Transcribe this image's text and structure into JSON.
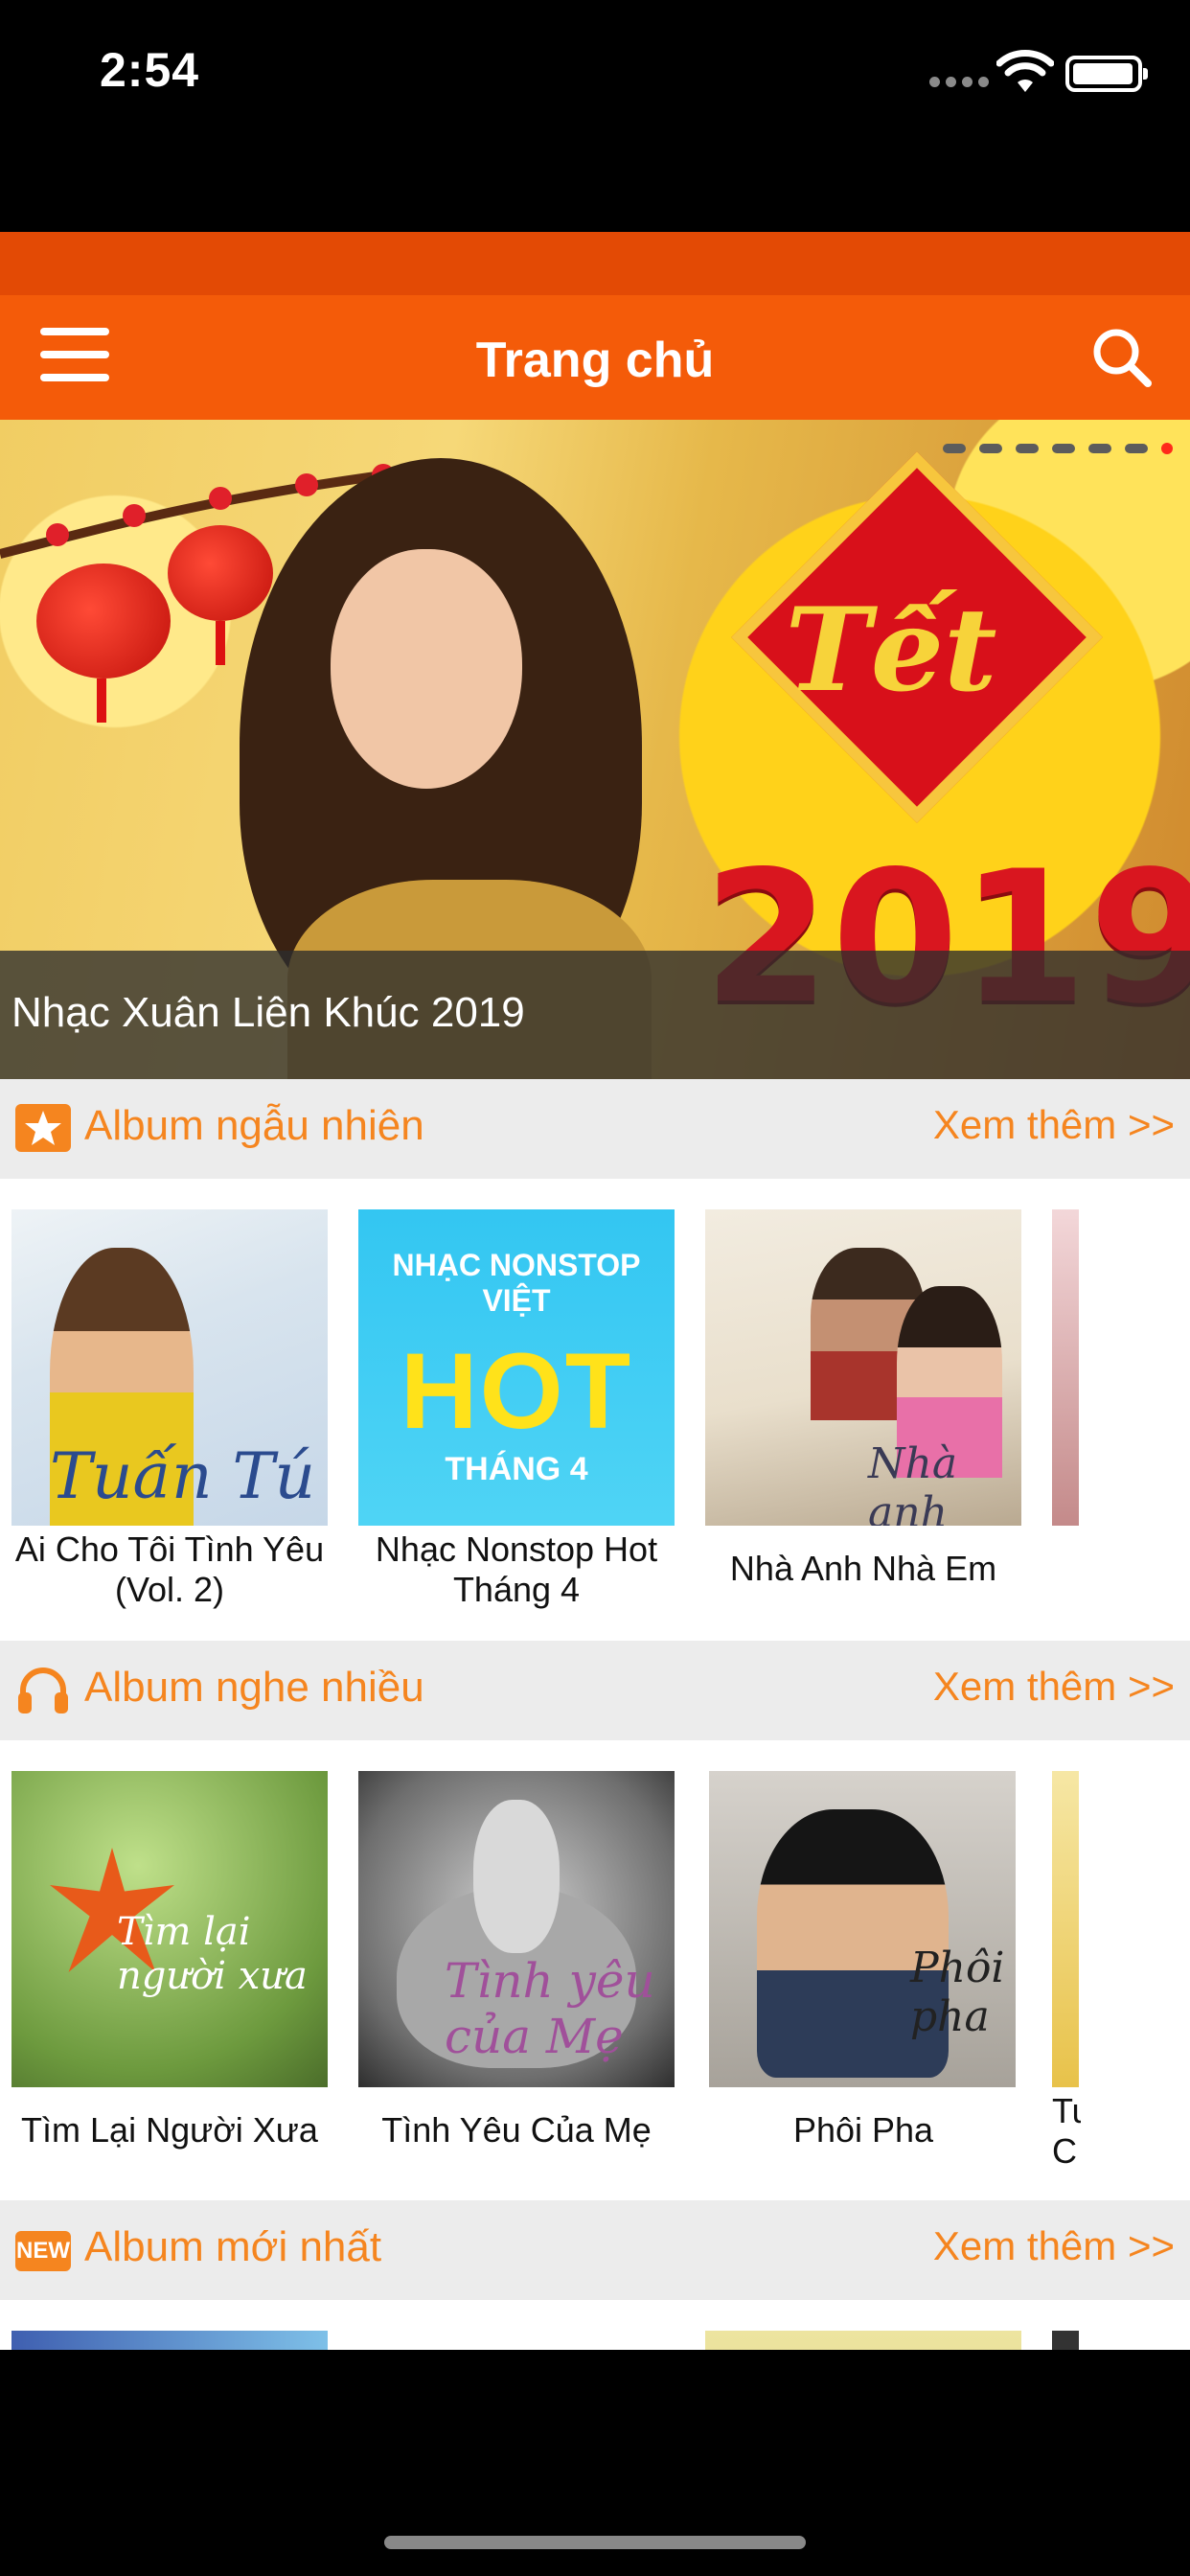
{
  "status_bar": {
    "time": "2:54"
  },
  "nav": {
    "title": "Trang chủ",
    "menu_icon": "hamburger-menu-icon",
    "search_icon": "search-icon"
  },
  "banner": {
    "caption": "Nhạc Xuân Liên Khúc 2019",
    "art_text": "Tết",
    "art_year": "2019",
    "page_count": 7,
    "active_page": 7
  },
  "sections": [
    {
      "title": "Album ngẫu nhiên",
      "more": "Xem thêm >>",
      "icon": "star-icon",
      "albums": [
        {
          "title": "Ai Cho Tôi Tình Yêu (Vol. 2)",
          "cover_text": "Tuấn Tú"
        },
        {
          "title": "Nhạc Nonstop Hot Tháng 4",
          "cover_line1": "NHẠC NONSTOP VIỆT",
          "cover_line2": "HOT",
          "cover_line3": "THÁNG 4"
        },
        {
          "title": "Nhà Anh Nhà Em",
          "cover_text": "Nhà anh Nhà em"
        }
      ]
    },
    {
      "title": "Album nghe nhiều",
      "more": "Xem thêm >>",
      "icon": "headphones-icon",
      "albums": [
        {
          "title": "Tìm Lại Người Xưa",
          "cover_text": "Tìm lại người xưa"
        },
        {
          "title": "Tình Yêu Của Mẹ",
          "cover_text": "Tình yêu của Mẹ"
        },
        {
          "title": "Phôi Pha",
          "cover_text": "Phôi pha"
        }
      ],
      "partial_caption_line1": "Tu",
      "partial_caption_line2": "C"
    },
    {
      "title": "Album mới nhất",
      "more": "Xem thêm >>",
      "icon": "new-badge-icon",
      "badge_text": "NEW"
    }
  ],
  "colors": {
    "accent": "#f45b09",
    "section_text": "#f5851f",
    "strip": "#e34a05"
  }
}
